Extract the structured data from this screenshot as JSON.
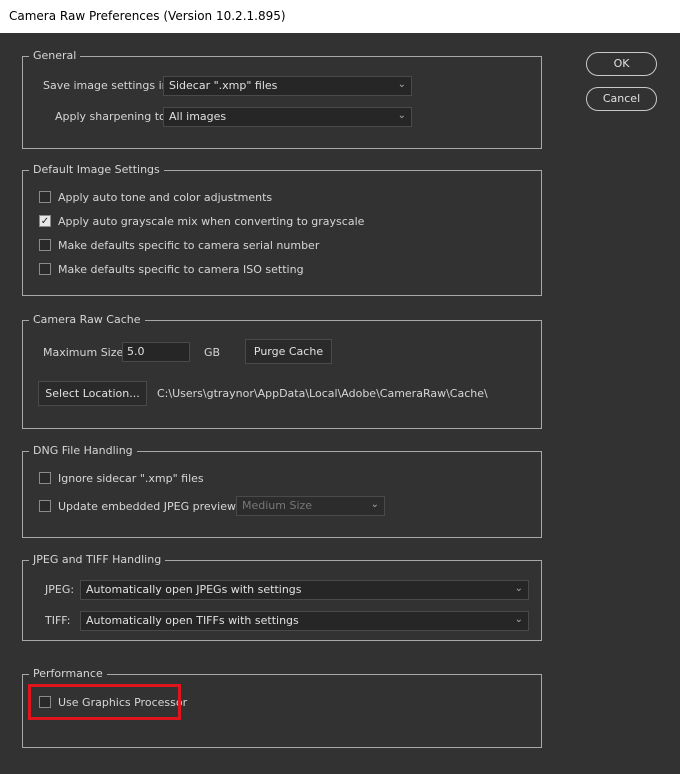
{
  "window": {
    "title": "Camera Raw Preferences  (Version 10.2.1.895)"
  },
  "buttons": {
    "ok": "OK",
    "cancel": "Cancel"
  },
  "general": {
    "title": "General",
    "save_label": "Save image settings in:",
    "save_value": "Sidecar \".xmp\" files",
    "sharpen_label": "Apply sharpening to:",
    "sharpen_value": "All images"
  },
  "defaults": {
    "title": "Default Image Settings",
    "items": [
      {
        "label": "Apply auto tone and color adjustments",
        "checked": false
      },
      {
        "label": "Apply auto grayscale mix when converting to grayscale",
        "checked": true
      },
      {
        "label": "Make defaults specific to camera serial number",
        "checked": false
      },
      {
        "label": "Make defaults specific to camera ISO setting",
        "checked": false
      }
    ]
  },
  "cache": {
    "title": "Camera Raw Cache",
    "max_label": "Maximum Size:",
    "max_value": "5.0",
    "unit": "GB",
    "purge": "Purge Cache",
    "select": "Select Location...",
    "path": "C:\\Users\\gtraynor\\AppData\\Local\\Adobe\\CameraRaw\\Cache\\"
  },
  "dng": {
    "title": "DNG File Handling",
    "ignore": "Ignore sidecar \".xmp\" files",
    "update": "Update embedded JPEG previews:",
    "preview_size": "Medium Size"
  },
  "jpeg_tiff": {
    "title": "JPEG and TIFF Handling",
    "jpeg_label": "JPEG:",
    "jpeg_value": "Automatically open JPEGs with settings",
    "tiff_label": "TIFF:",
    "tiff_value": "Automatically open TIFFs with settings"
  },
  "performance": {
    "title": "Performance",
    "gpu": "Use Graphics Processor",
    "highlight_color": "#e0141c"
  }
}
